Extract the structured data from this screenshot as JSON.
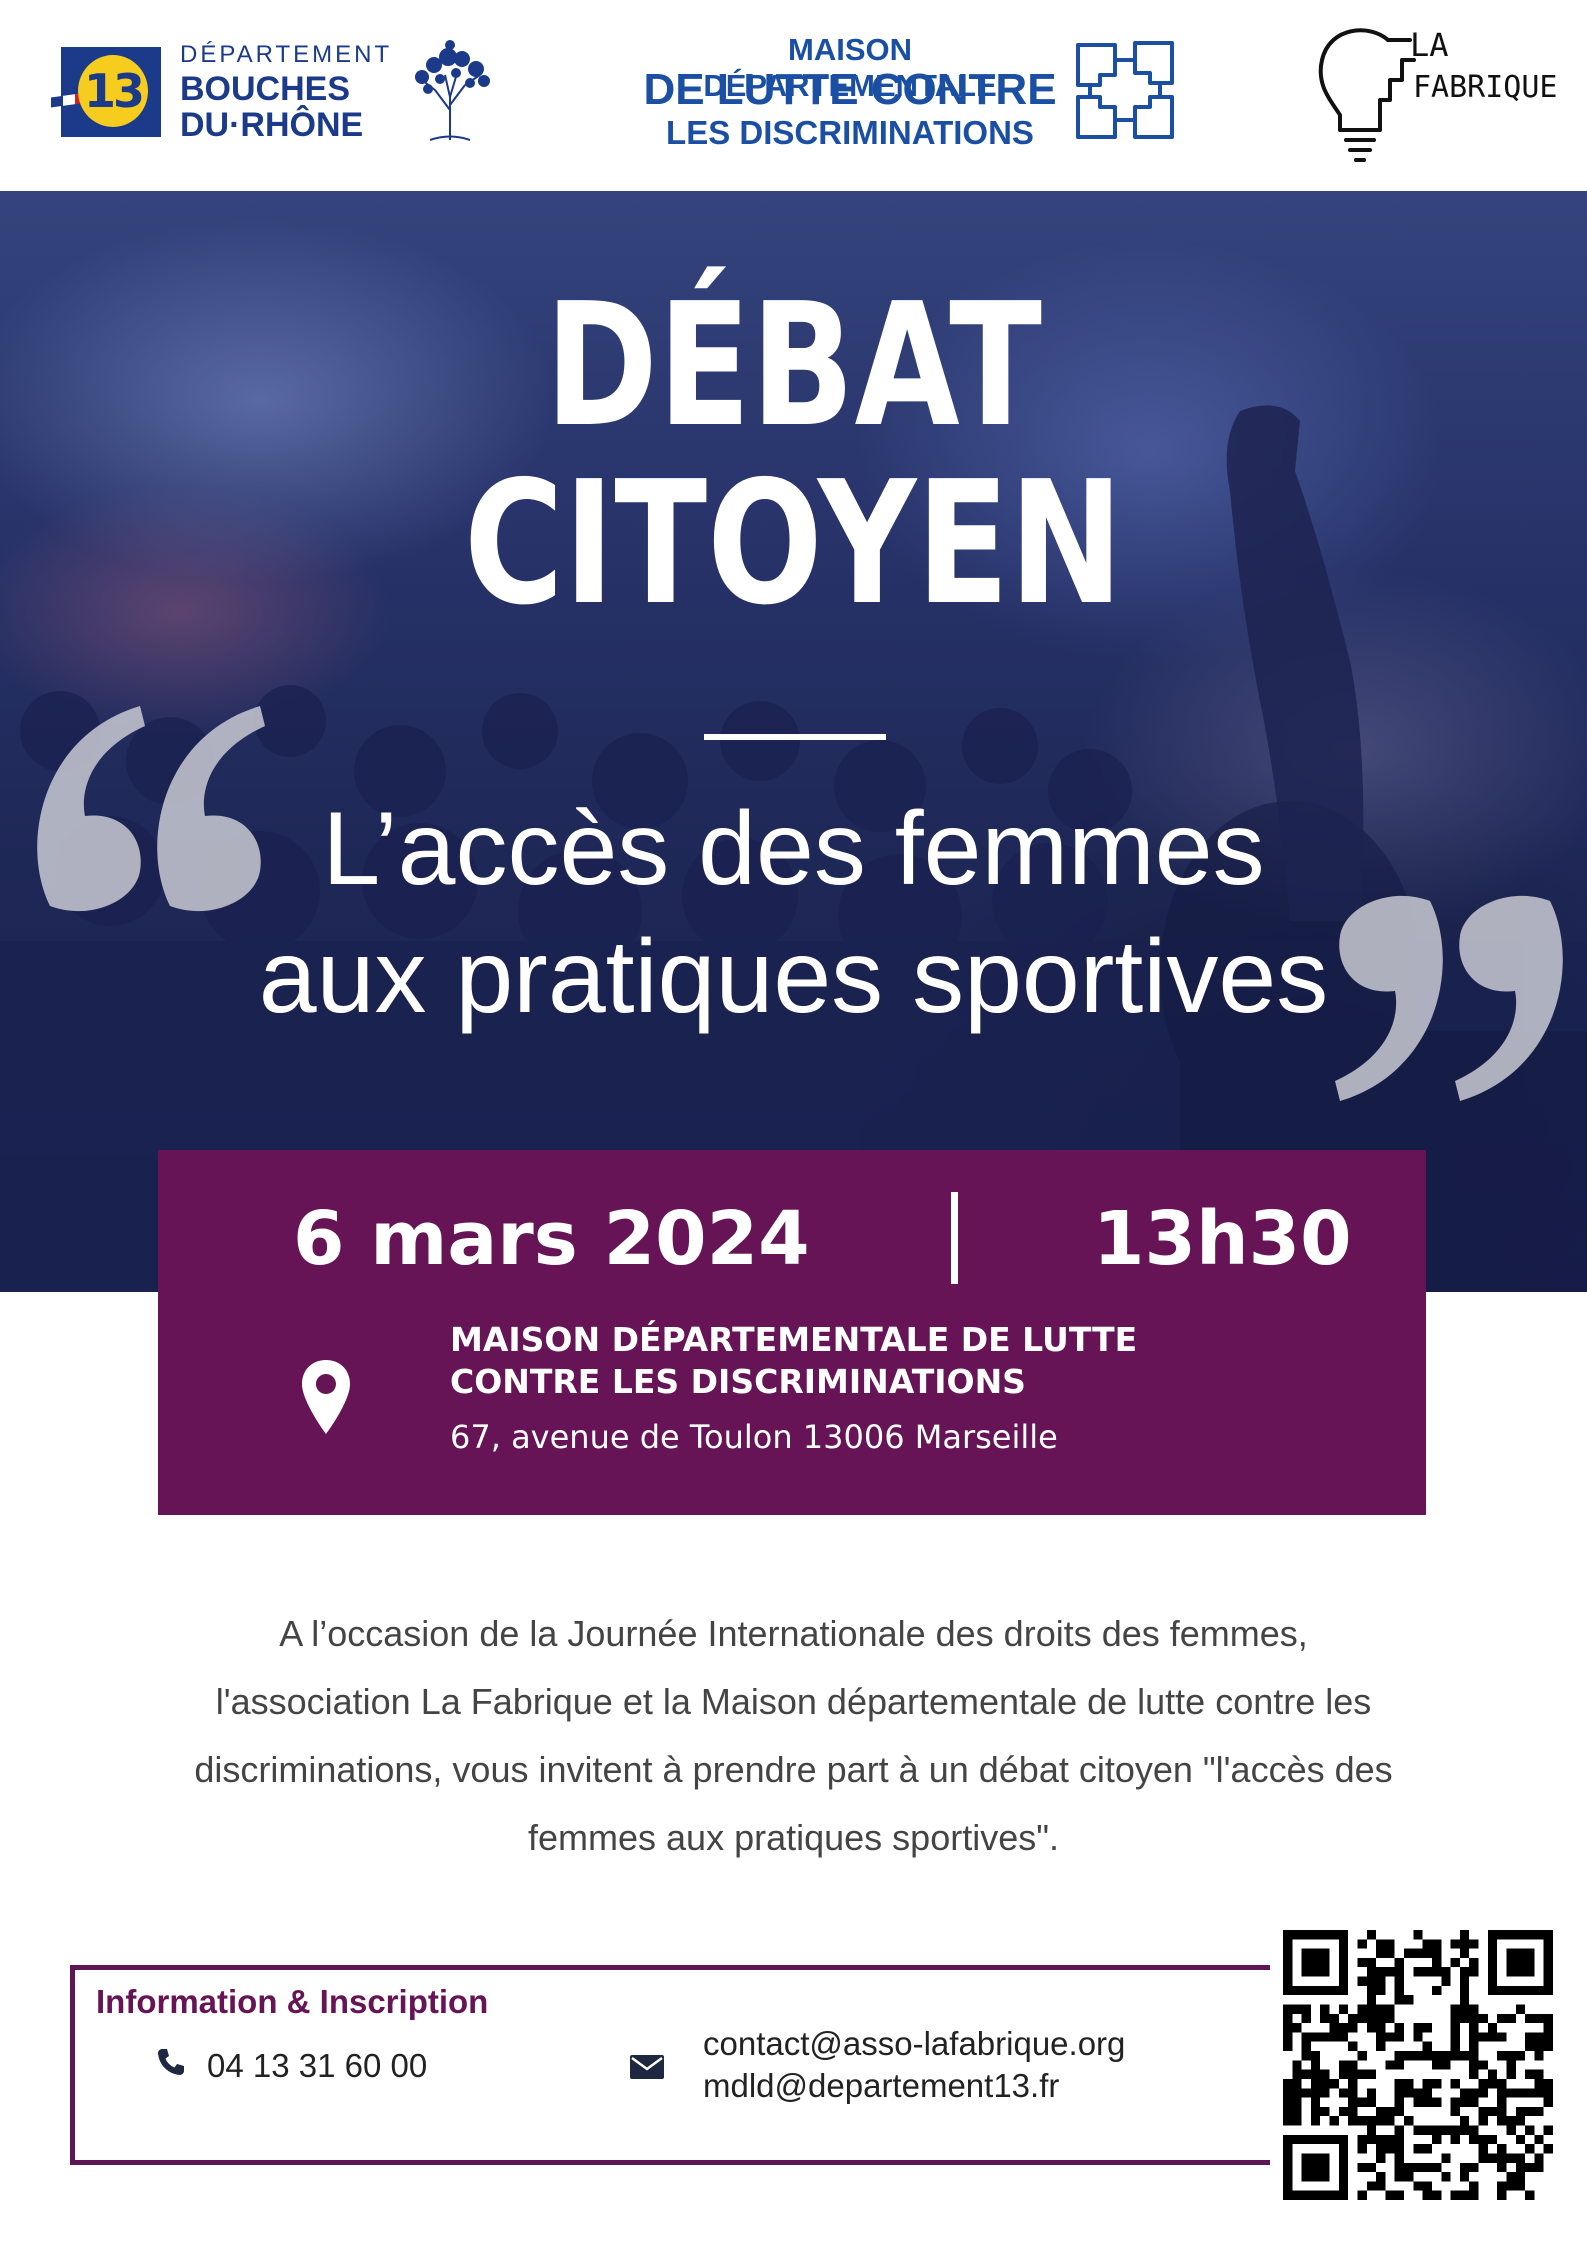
{
  "header": {
    "cd13": {
      "badge_number": "13",
      "line1": "DÉPARTEMENT",
      "line2": "BOUCHES",
      "line3": "DU·RHÔNE"
    },
    "mdld": {
      "line1": "MAISON DÉPARTEMENTALE",
      "line2": "DE LUTTE CONTRE",
      "line3": "LES DISCRIMINATIONS"
    },
    "fabrique": {
      "line1": "LA",
      "line2": "FABRIQUE"
    }
  },
  "hero": {
    "title_line1": "DÉBAT",
    "title_line2": "CITOYEN",
    "subtitle_line1": "L’accès des femmes",
    "subtitle_line2": "aux pratiques sportives"
  },
  "event": {
    "date": "6 mars 2024",
    "time": "13h30",
    "venue_line1": "MAISON DÉPARTEMENTALE DE LUTTE",
    "venue_line2": "CONTRE LES DISCRIMINATIONS",
    "address": "67, avenue de Toulon 13006 Marseille"
  },
  "description": {
    "line1": "A l’occasion de la Journée Internationale des droits des femmes,",
    "line2": "l'association La Fabrique et la Maison départementale de lutte contre les",
    "line3": "discriminations, vous invitent à prendre part à un débat citoyen \"l'accès des",
    "line4": "femmes aux pratiques sportives\"."
  },
  "contact": {
    "title": "Information & Inscription",
    "phone": "04 13 31 60 00",
    "email1": "contact@asso-lafabrique.org",
    "email2": "mdld@departement13.fr"
  },
  "colors": {
    "brand_purple": "#661456",
    "brand_blue": "#1a4fa3",
    "cd13_yellow": "#f6cd1f",
    "hero_navy": "#2a3670"
  },
  "icons": {
    "location": "map-pin-icon",
    "phone": "phone-icon",
    "mail": "envelope-icon",
    "qr": "qr-code"
  }
}
